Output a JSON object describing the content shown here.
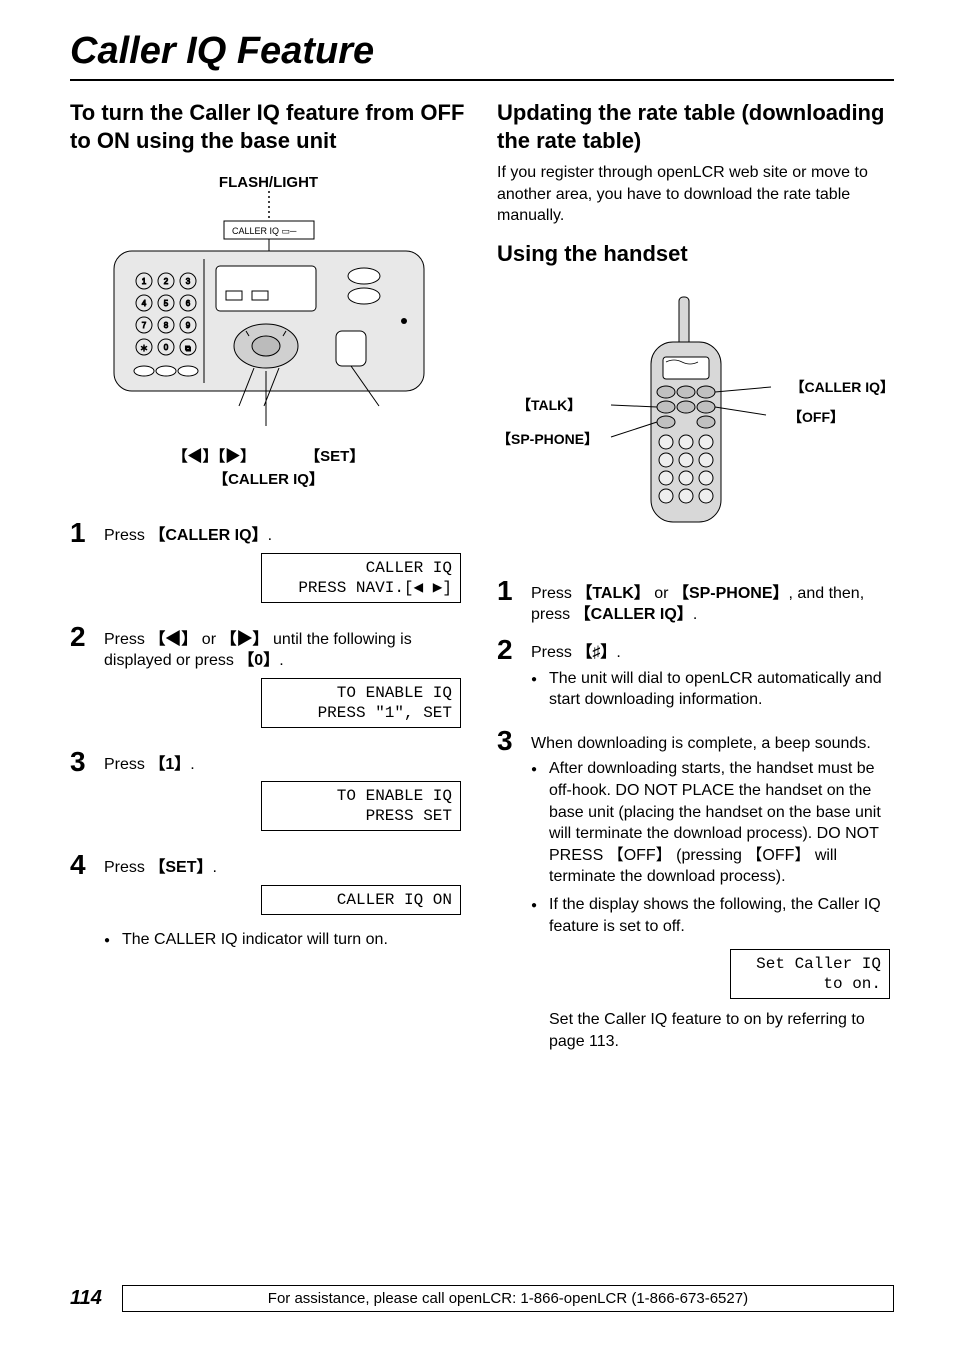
{
  "page_title": "Caller IQ Feature",
  "left": {
    "heading": "To turn the Caller IQ feature from OFF to ON using the base unit",
    "diagram": {
      "flash_light_label": "FLASH/LIGHT",
      "caller_iq_indicator": "CALLER IQ",
      "nav_label": "【◀】【▶】",
      "set_label": "【SET】",
      "caller_iq_btn": "【CALLER IQ】"
    },
    "steps": [
      {
        "num": "1",
        "text_before": "Press ",
        "btn": "【CALLER IQ】",
        "text_after": ".",
        "lcd": " CALLER IQ\nPRESS NAVI.[◀ ▶]"
      },
      {
        "num": "2",
        "text_full": "Press 【◀】 or 【▶】 until the following is displayed or press 【0】.",
        "lcd": "  TO ENABLE IQ\nPRESS \"1\", SET"
      },
      {
        "num": "3",
        "text_before": "Press ",
        "btn": "【1】",
        "text_after": ".",
        "lcd": "  TO ENABLE IQ\nPRESS SET"
      },
      {
        "num": "4",
        "text_before": "Press ",
        "btn": "【SET】",
        "text_after": ".",
        "lcd": "CALLER IQ ON",
        "bullet": "The CALLER IQ indicator will turn on."
      }
    ]
  },
  "right": {
    "heading1": "Updating the rate table (downloading the rate table)",
    "intro": "If you register through openLCR web site or move to another area, you have to download the rate table manually.",
    "heading2": "Using the handset",
    "handset_labels": {
      "talk": "【TALK】",
      "sp_phone": "【SP-PHONE】",
      "caller_iq": "【CALLER IQ】",
      "off": "【OFF】"
    },
    "steps": [
      {
        "num": "1",
        "text": "Press 【TALK】 or 【SP-PHONE】, and then, press 【CALLER IQ】."
      },
      {
        "num": "2",
        "text": "Press 【♯】.",
        "bullets": [
          "The unit will dial to openLCR automatically and start downloading information."
        ]
      },
      {
        "num": "3",
        "text": "When downloading is complete, a beep sounds.",
        "bullets": [
          "After downloading starts, the handset must be off-hook. DO NOT PLACE the handset on the base unit (placing the handset on the base unit will terminate the download process). DO NOT PRESS 【OFF】 (pressing 【OFF】 will terminate the download process).",
          "If the display shows the following, the Caller IQ feature is set to off."
        ],
        "lcd": "Set Caller IQ\nto on.",
        "tail": "Set the Caller IQ feature to on by referring to page 113."
      }
    ]
  },
  "footer": {
    "page_num": "114",
    "assist": "For assistance, please call openLCR: 1-866-openLCR (1-866-673-6527)"
  }
}
